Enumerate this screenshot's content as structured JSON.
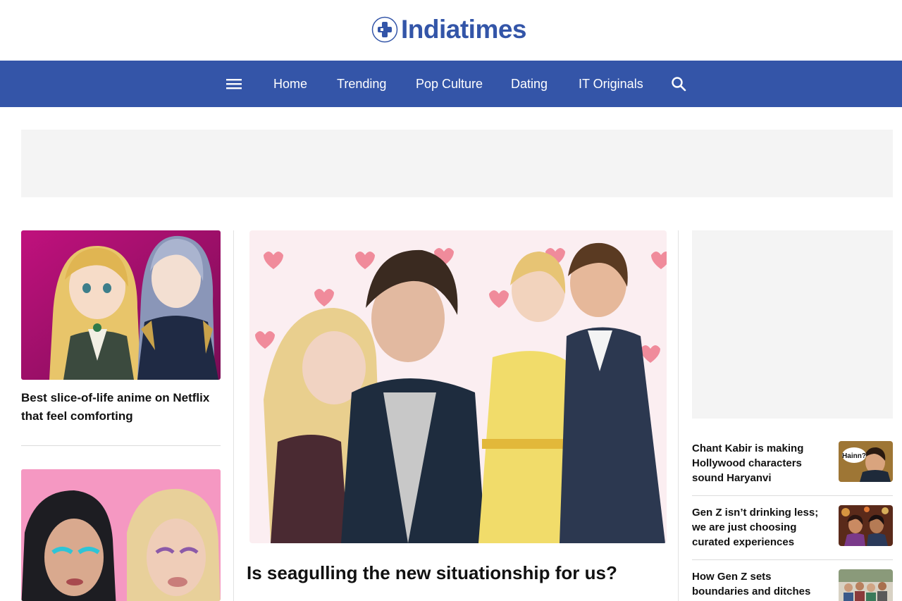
{
  "brand": {
    "name": "Indiatimes",
    "color": "#3355a8"
  },
  "nav": {
    "menu_icon": "hamburger-menu-icon",
    "items": [
      {
        "label": "Home"
      },
      {
        "label": "Trending"
      },
      {
        "label": "Pop Culture"
      },
      {
        "label": "Dating"
      },
      {
        "label": "IT Originals"
      }
    ],
    "search_icon": "search-icon",
    "background": "#3455a8"
  },
  "left_column": {
    "articles": [
      {
        "title": "Best slice-of-life anime on Netflix that feel comforting",
        "image": "anime-characters-image"
      },
      {
        "title": "",
        "image": "makeup-looks-image"
      }
    ]
  },
  "featured": {
    "title": "Is seagulling the new situationship for us?",
    "image": "couples-hearts-collage-image"
  },
  "right_column": {
    "articles": [
      {
        "title": "Chant Kabir is making Hollywood characters sound Haryanvi",
        "image": "haryanvi-meme-thumbnail",
        "badge": "Hainn?"
      },
      {
        "title": "Gen Z isn’t drinking less; we are just choosing curated experiences",
        "image": "party-thumbnail"
      },
      {
        "title": "How Gen Z sets boundaries and ditches",
        "image": "group-thumbnail"
      }
    ]
  }
}
